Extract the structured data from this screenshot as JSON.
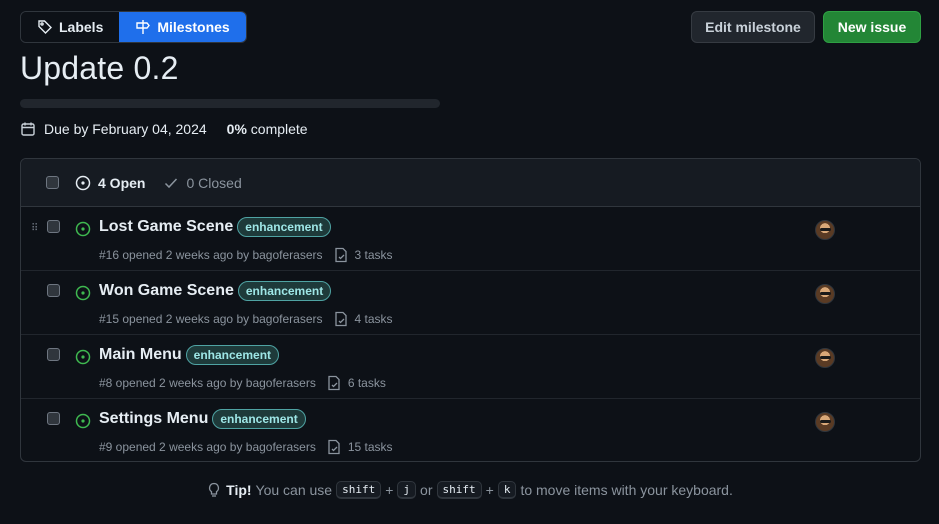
{
  "nav": {
    "labels_label": "Labels",
    "milestones_label": "Milestones"
  },
  "actions": {
    "edit_label": "Edit milestone",
    "new_label": "New issue"
  },
  "milestone": {
    "title": "Update 0.2",
    "due": "Due by February 04, 2024",
    "percent": "0%",
    "complete_label": "complete",
    "progress_fraction": 0
  },
  "issues_header": {
    "open_label": "4 Open",
    "closed_label": "0 Closed"
  },
  "issues": [
    {
      "title": "Lost Game Scene",
      "label": "enhancement",
      "meta": "#16 opened 2 weeks ago by bagoferasers",
      "tasks": "3 tasks"
    },
    {
      "title": "Won Game Scene",
      "label": "enhancement",
      "meta": "#15 opened 2 weeks ago by bagoferasers",
      "tasks": "4 tasks"
    },
    {
      "title": "Main Menu",
      "label": "enhancement",
      "meta": "#8 opened 2 weeks ago by bagoferasers",
      "tasks": "6 tasks"
    },
    {
      "title": "Settings Menu",
      "label": "enhancement",
      "meta": "#9 opened 2 weeks ago by bagoferasers",
      "tasks": "15 tasks"
    }
  ],
  "tip": {
    "prefix": "Tip!",
    "text1": "You can use",
    "key1": "shift",
    "plus1": "+",
    "key2": "j",
    "or": "or",
    "key3": "shift",
    "plus2": "+",
    "key4": "k",
    "text2": "to move items with your keyboard."
  },
  "colors": {
    "accent": "#1f6feb",
    "success": "#238636",
    "open_icon": "#3fb950",
    "label_text": "#9ee6e6"
  },
  "icons": {
    "labels": "tag-icon",
    "milestones": "milestone-icon",
    "due": "calendar-icon",
    "open": "issue-opened-icon",
    "closed": "check-icon",
    "tasks": "tasklist-icon",
    "tip": "light-bulb-icon"
  }
}
